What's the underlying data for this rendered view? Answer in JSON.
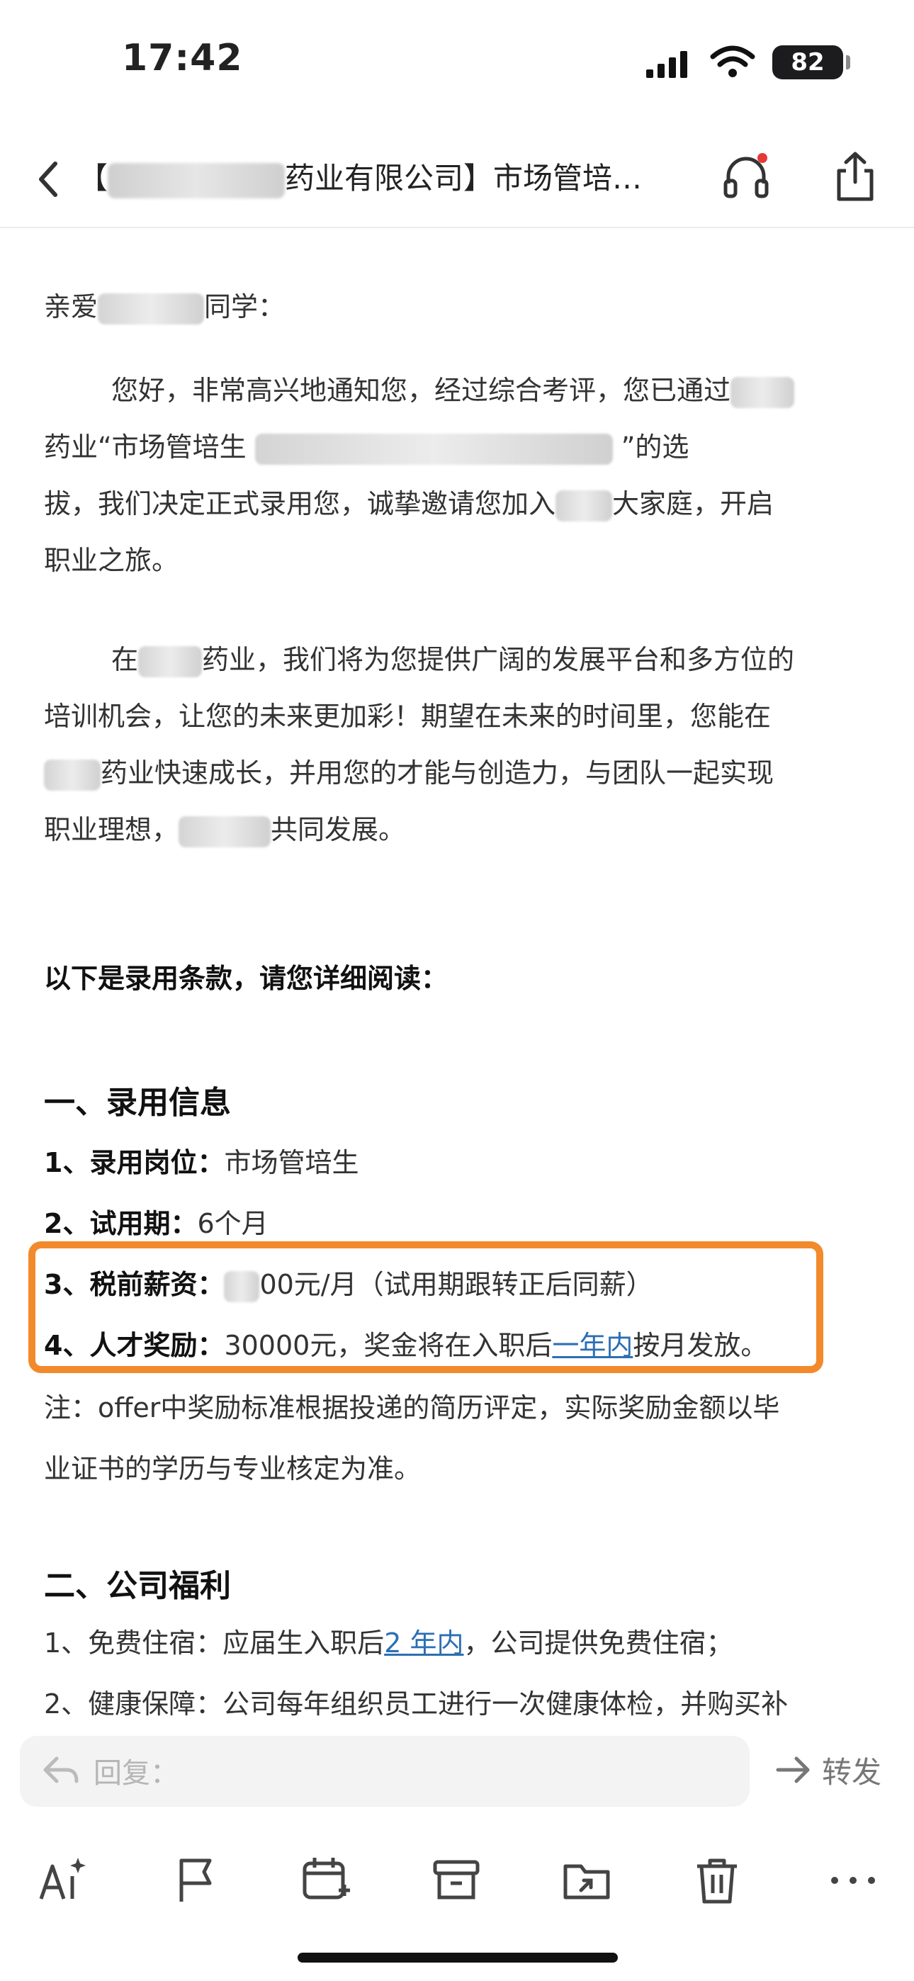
{
  "status_bar": {
    "time": "17:42",
    "battery": "82"
  },
  "header": {
    "title_prefix": "【",
    "title_suffix": "药业有限公司】市场管培…"
  },
  "email": {
    "greeting_a": "亲爱",
    "greeting_b": "同学：",
    "p1_l1": "您好，非常高兴地通知您，经过综合考评，您已通过",
    "p1_l2_a": "药业“市场管培生",
    "p1_l2_b": "”的选",
    "p1_l3_a": "拔，我们决定正式录用您，诚挚邀请您加入",
    "p1_l3_b": "大家庭，开启",
    "p1_l4": "职业之旅。",
    "p2_l1_a": "在",
    "p2_l1_b": "药业，我们将为您提供广阔的发展平台和多方位的",
    "p2_l2": "培训机会，让您的未来更加彩！期望在未来的时间里，您能在",
    "p2_l3": "药业快速成长，并用您的才能与创造力，与团队一起实现",
    "p2_l4_a": "职业理想，",
    "p2_l4_b": "共同发展。",
    "terms_intro": "以下是录用条款，请您详细阅读：",
    "section1_title": "一、录用信息",
    "item1_label": "1、录用岗位：",
    "item1_value": "市场管培生",
    "item2_label": "2、试用期：",
    "item2_value": "6个月",
    "item3_label": "3、税前薪资：",
    "item3_value": "00元/月（试用期跟转正后同薪）",
    "item4_label": "4、人才奖励：",
    "item4_value_a": "30000元，奖金将在入职后",
    "item4_link": "一年内",
    "item4_value_b": "按月发放。",
    "note_l1": "注：offer中奖励标准根据投递的简历评定，实际奖励金额以毕",
    "note_l2": "业证书的学历与专业核定为准。",
    "section2_title": "二、公司福利",
    "benefit1_a": "1、免费住宿：应届生入职后",
    "benefit1_link": "2 年内",
    "benefit1_b": "，公司提供免费住宿；",
    "benefit2": "2、健康保障：公司每年组织员工进行一次健康体检，并购买补"
  },
  "reply_bar": {
    "reply_placeholder": "回复：",
    "forward_label": "转发"
  },
  "colors": {
    "highlight_border": "#f28a2c",
    "link": "#2b6fb4",
    "unread_dot": "#e53935"
  },
  "icons": [
    "back-icon",
    "headphone-icon",
    "share-icon",
    "reply-icon",
    "forward-icon",
    "ai-icon",
    "flag-icon",
    "calendar-add-icon",
    "archive-icon",
    "move-folder-icon",
    "trash-icon",
    "more-icon"
  ]
}
